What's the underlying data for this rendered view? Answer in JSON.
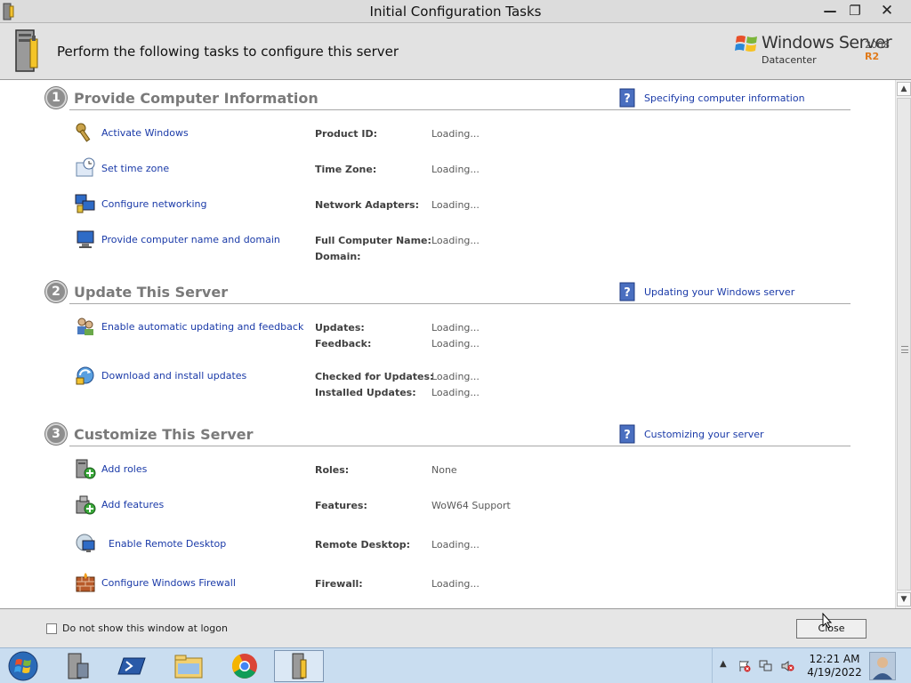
{
  "window": {
    "title": "Initial Configuration Tasks",
    "minimize": "—",
    "maximize": "❐",
    "close": "✕"
  },
  "header": {
    "subtitle": "Perform the following tasks to configure this server",
    "brand_product": "Windows Server",
    "brand_version": "2008",
    "brand_release": "R2",
    "brand_edition": "Datacenter"
  },
  "sections": [
    {
      "number": "1",
      "title": "Provide Computer Information",
      "help_link": "Specifying computer information",
      "tasks": [
        {
          "label": "Activate Windows",
          "icon": "key-icon"
        },
        {
          "label": "Set time zone",
          "icon": "clock-icon"
        },
        {
          "label": "Configure networking",
          "icon": "network-icon"
        },
        {
          "label": "Provide computer name and domain",
          "icon": "computer-icon"
        }
      ],
      "fields": [
        {
          "label": "Product ID:",
          "value": "Loading..."
        },
        {
          "label": "Time Zone:",
          "value": "Loading..."
        },
        {
          "label": "Network Adapters:",
          "value": "Loading..."
        },
        {
          "label": "Full Computer Name:",
          "value": "Loading..."
        },
        {
          "label": "Domain:",
          "value": ""
        }
      ]
    },
    {
      "number": "2",
      "title": "Update This Server",
      "help_link": "Updating your Windows server",
      "tasks": [
        {
          "label": "Enable automatic updating and feedback",
          "icon": "users-icon"
        },
        {
          "label": "Download and install updates",
          "icon": "update-icon"
        }
      ],
      "fields": [
        {
          "label": "Updates:",
          "value": "Loading..."
        },
        {
          "label": "Feedback:",
          "value": "Loading..."
        },
        {
          "label": "Checked for Updates:",
          "value": "Loading..."
        },
        {
          "label": "Installed Updates:",
          "value": "Loading..."
        }
      ]
    },
    {
      "number": "3",
      "title": "Customize This Server",
      "help_link": "Customizing your server",
      "tasks": [
        {
          "label": "Add roles",
          "icon": "add-roles-icon"
        },
        {
          "label": "Add features",
          "icon": "add-features-icon"
        },
        {
          "label": "Enable Remote Desktop",
          "icon": "remote-desktop-icon"
        },
        {
          "label": "Configure Windows Firewall",
          "icon": "firewall-icon"
        }
      ],
      "fields": [
        {
          "label": "Roles:",
          "value": "None"
        },
        {
          "label": "Features:",
          "value": "WoW64 Support"
        },
        {
          "label": "Remote Desktop:",
          "value": "Loading..."
        },
        {
          "label": "Firewall:",
          "value": "Loading..."
        }
      ]
    }
  ],
  "footer": {
    "checkbox_label": "Do not show this window at logon",
    "checkbox_checked": false,
    "close_button": "Close"
  },
  "taskbar": {
    "pinned": [
      "server-manager-icon",
      "powershell-icon",
      "explorer-icon",
      "chrome-icon",
      "initial-config-icon"
    ],
    "active": "initial-config-icon",
    "clock_time": "12:21 AM",
    "clock_date": "4/19/2022"
  },
  "colors": {
    "link": "#1a3aa8",
    "section_title": "#7a7a7a",
    "header_bg": "#e2e2e2",
    "taskbar_bg": "#c9ddf0"
  }
}
